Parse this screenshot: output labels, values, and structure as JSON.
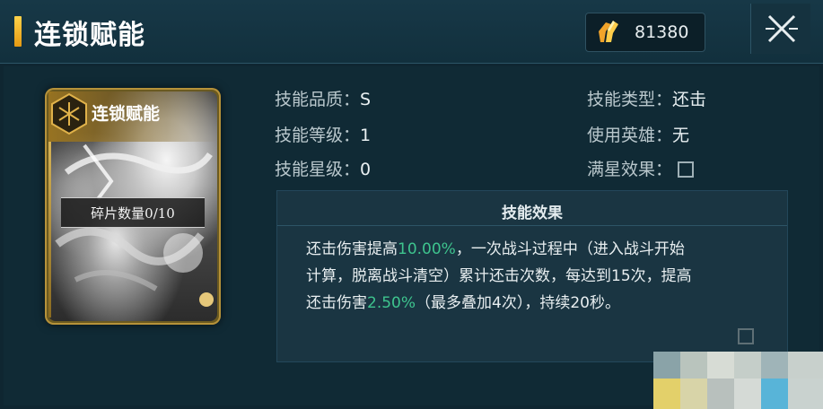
{
  "header": {
    "title": "连锁赋能",
    "currency_value": "81380",
    "currency_icon": "gold-crystal-icon",
    "close_icon": "close-x-icon"
  },
  "card": {
    "title": "连锁赋能",
    "fragment_text": "碎片数量0/10",
    "emblem_icon": "hexagon-emblem-icon"
  },
  "info": {
    "quality_label": "技能品质：",
    "quality_value": "S",
    "level_label": "技能等级：",
    "level_value": "1",
    "star_label": "技能星级：",
    "star_value": "0",
    "type_label": "技能类型：",
    "type_value": "还击",
    "hero_label": "使用英雄：",
    "hero_value": "无",
    "fullstar_label": "满星效果："
  },
  "effect": {
    "title": "技能效果",
    "line1_a": "还击伤害提高",
    "line1_hl": "10.00%",
    "line1_b": "，一次战斗过程中（进入战斗开始",
    "line2": "计算，脱离战斗清空）累计还击次数，每达到15次，提高",
    "line3_a": "还击伤害",
    "line3_hl": "2.50%",
    "line3_b": "（最多叠加4次），持续20秒。",
    "highlight_color": "#3ec48e"
  },
  "colors": {
    "background": "#0f2631",
    "accent_gold": "#ffd24a"
  }
}
